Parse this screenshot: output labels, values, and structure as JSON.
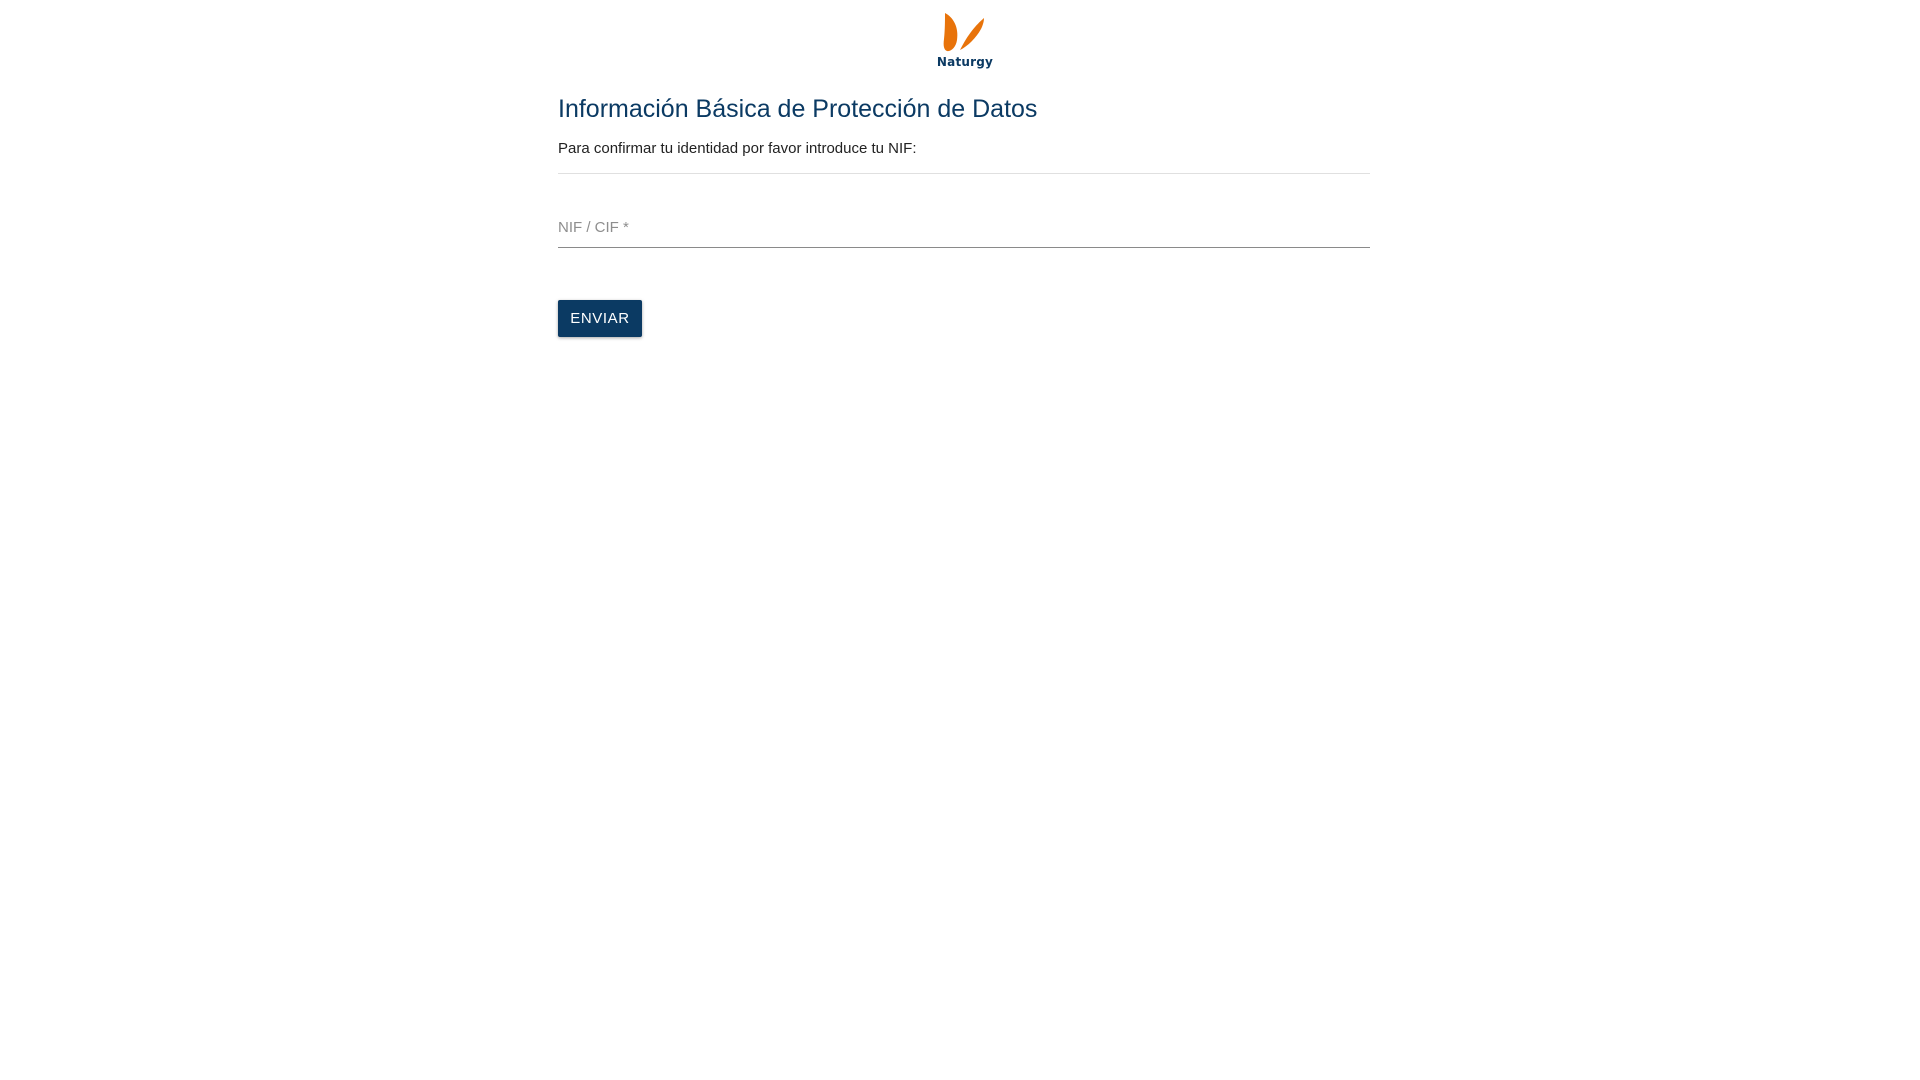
{
  "brand": {
    "name": "Naturgy",
    "primary_color": "#0b3a63",
    "accent_color": "#e8730a",
    "logo_icon": "butterfly-icon"
  },
  "main": {
    "title": "Información Básica de Protección de Datos",
    "instructions": "Para confirmar tu identidad por favor introduce tu NIF:",
    "form": {
      "nif_label": "NIF / CIF *",
      "nif_value": "",
      "submit_label": "ENVIAR"
    }
  }
}
